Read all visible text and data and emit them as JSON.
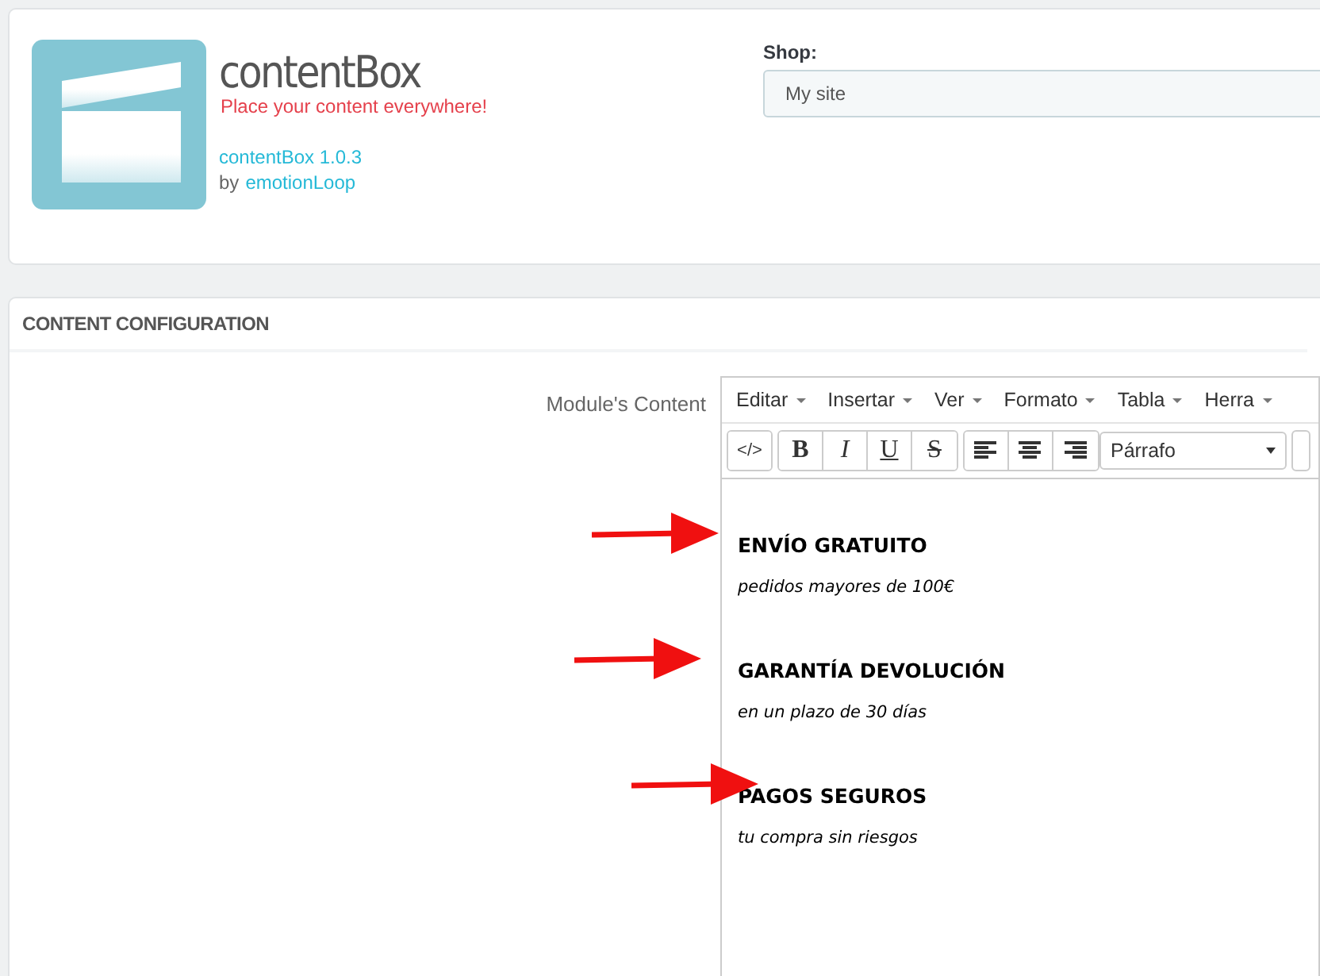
{
  "module": {
    "name": "contentBox",
    "tagline": "Place your content everywhere!",
    "version": "contentBox 1.0.3",
    "by": "by",
    "author": "emotionLoop"
  },
  "shop": {
    "label": "Shop:",
    "value": "My site"
  },
  "panel": {
    "title": "CONTENT CONFIGURATION",
    "field_label": "Module's Content"
  },
  "editor": {
    "menus": [
      "Editar",
      "Insertar",
      "Ver",
      "Formato",
      "Tabla",
      "Herra"
    ],
    "toolbar": [
      {
        "kind": "code",
        "label": "</>"
      },
      {
        "kind": "bold",
        "label": "B"
      },
      {
        "kind": "italic",
        "label": "I"
      },
      {
        "kind": "underline",
        "label": "U"
      },
      {
        "kind": "strike",
        "label": "S"
      },
      {
        "kind": "align-left"
      },
      {
        "kind": "align-center"
      },
      {
        "kind": "align-right"
      }
    ],
    "format": "Párrafo",
    "blocks": [
      {
        "heading": "ENVÍO GRATUITO",
        "text": "pedidos mayores de 100€",
        "arrow": true
      },
      {
        "heading": "GARANTÍA DEVOLUCIÓN",
        "text": "en un plazo de 30 días",
        "arrow": true
      },
      {
        "heading": "PAGOS SEGUROS",
        "text": "tu compra sin riesgos",
        "arrow": true
      }
    ]
  }
}
